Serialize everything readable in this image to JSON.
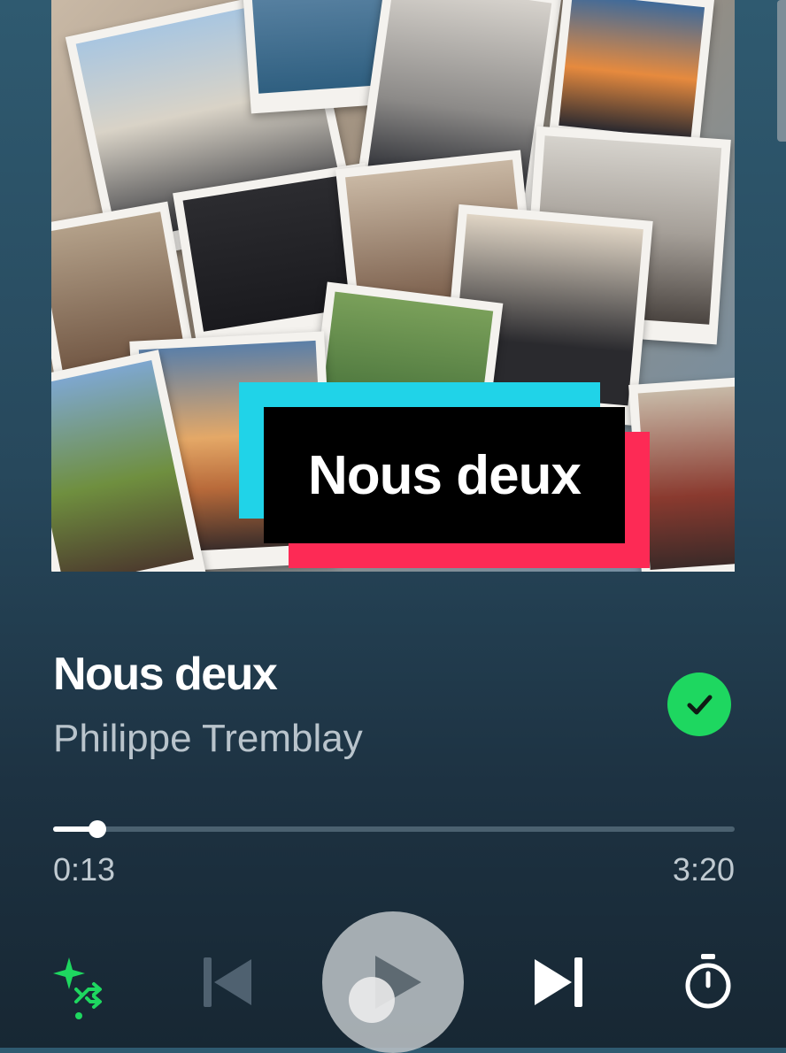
{
  "cover": {
    "title": "Nous deux",
    "colors": {
      "cyan": "#20d3e8",
      "pink": "#fd2a55",
      "box": "#000000"
    }
  },
  "track": {
    "title": "Nous deux",
    "artist": "Philippe Tremblay",
    "saved": true
  },
  "progress": {
    "elapsed": "0:13",
    "total": "3:20",
    "fraction": 0.065
  },
  "controls": [
    {
      "name": "smart-shuffle-button",
      "icon": "sparkle-shuffle-icon",
      "active": true
    },
    {
      "name": "previous-button",
      "icon": "skip-previous-icon",
      "enabled": false
    },
    {
      "name": "play-button",
      "icon": "play-icon"
    },
    {
      "name": "next-button",
      "icon": "skip-next-icon"
    },
    {
      "name": "sleep-timer-button",
      "icon": "timer-icon"
    }
  ],
  "theme": {
    "accent": "#1ed760",
    "text_primary": "#ffffff",
    "text_secondary": "#b9c4cc"
  }
}
